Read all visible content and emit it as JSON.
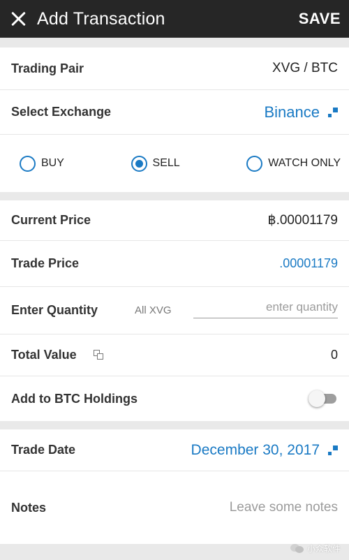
{
  "header": {
    "title": "Add Transaction",
    "save_label": "SAVE"
  },
  "pair": {
    "label": "Trading Pair",
    "value": "XVG / BTC"
  },
  "exchange": {
    "label": "Select Exchange",
    "value": "Binance"
  },
  "type_options": [
    {
      "label": "BUY",
      "selected": false
    },
    {
      "label": "SELL",
      "selected": true
    },
    {
      "label": "WATCH ONLY",
      "selected": false
    }
  ],
  "current_price": {
    "label": "Current Price",
    "value": "฿.00001179"
  },
  "trade_price": {
    "label": "Trade Price",
    "value": ".00001179"
  },
  "quantity": {
    "label": "Enter Quantity",
    "hint": "All XVG",
    "placeholder": "enter quantity",
    "value": ""
  },
  "total": {
    "label": "Total Value",
    "value": "0"
  },
  "holdings": {
    "label": "Add to BTC Holdings",
    "enabled": false
  },
  "trade_date": {
    "label": "Trade Date",
    "value": "December 30, 2017"
  },
  "notes": {
    "label": "Notes",
    "placeholder": "Leave some notes"
  },
  "watermark": {
    "text": "小众软件"
  },
  "colors": {
    "accent": "#1a7ac4",
    "topbar": "#262626",
    "background": "#e9e9e9"
  }
}
